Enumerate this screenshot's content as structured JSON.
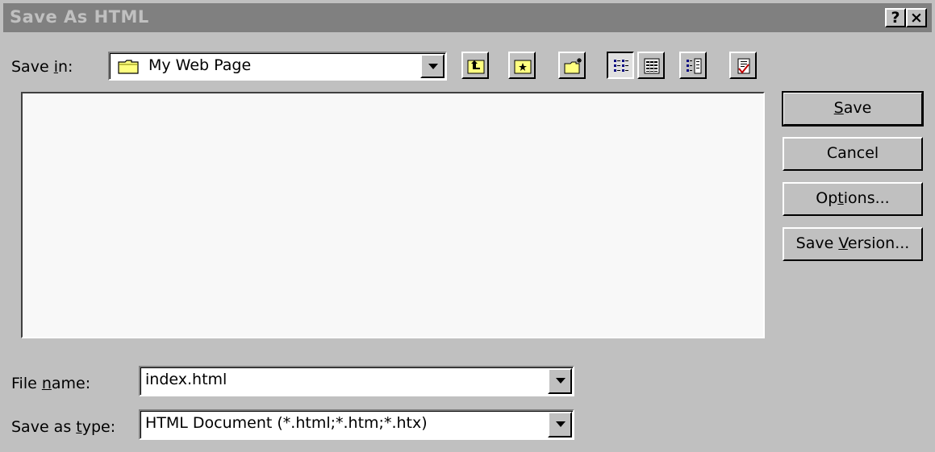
{
  "window": {
    "title": "Save As HTML",
    "help_button": "?",
    "close_button": "×"
  },
  "save_in": {
    "label_pre": "Save ",
    "label_key": "i",
    "label_post": "n:",
    "value": "My Web Page",
    "icon": "folder-icon"
  },
  "toolbar": {
    "buttons": [
      {
        "name": "up-one-level-button",
        "icon": "folder-up-icon"
      },
      {
        "name": "look-in-favorites-button",
        "icon": "favorites-folder-icon"
      },
      {
        "name": "create-new-folder-button",
        "icon": "new-folder-icon"
      },
      {
        "name": "list-view-button",
        "icon": "list-view-icon",
        "pressed": true
      },
      {
        "name": "details-view-button",
        "icon": "details-view-icon"
      },
      {
        "name": "properties-view-button",
        "icon": "properties-view-icon"
      },
      {
        "name": "commands-and-settings-button",
        "icon": "commands-icon"
      }
    ]
  },
  "file_name": {
    "label_pre": "File ",
    "label_key": "n",
    "label_post": "ame:",
    "value": "index.html"
  },
  "save_as_type": {
    "label_pre": "Save as ",
    "label_key": "t",
    "label_post": "ype:",
    "value": "HTML Document (*.html;*.htm;*.htx)"
  },
  "buttons": {
    "save": {
      "pre": "",
      "key": "S",
      "post": "ave"
    },
    "cancel": {
      "label": "Cancel"
    },
    "options": {
      "pre": "Op",
      "key": "t",
      "post": "ions..."
    },
    "save_version": {
      "pre": "Save ",
      "key": "V",
      "post": "ersion..."
    }
  },
  "colors": {
    "face": "#c0c0c0",
    "titlebar_inactive": "#808080",
    "list_background": "#f8f8f8",
    "folder_yellow": "#ffff80"
  }
}
